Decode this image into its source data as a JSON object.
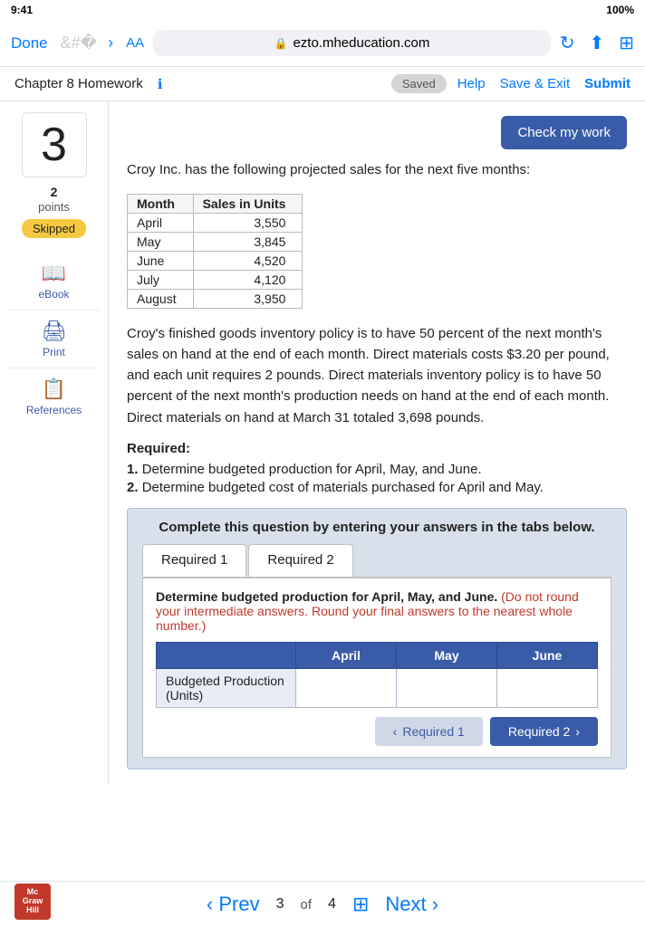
{
  "status_bar": {
    "left": "9:41",
    "right": "100%"
  },
  "browser": {
    "done_label": "Done",
    "aa_label": "AA",
    "url": "ezto.mheducation.com",
    "back_disabled": true,
    "forward_disabled": false
  },
  "top_nav": {
    "chapter_title": "Chapter 8 Homework",
    "saved_label": "Saved",
    "help_label": "Help",
    "save_exit_label": "Save & Exit",
    "submit_label": "Submit"
  },
  "question": {
    "number": "3",
    "points": "2",
    "points_label": "points",
    "status": "Skipped",
    "check_button_label": "Check my work"
  },
  "sidebar_tools": [
    {
      "icon": "📖",
      "label": "eBook"
    },
    {
      "icon": "🖨",
      "label": "Print"
    },
    {
      "icon": "📋",
      "label": "References"
    }
  ],
  "question_text": "Croy Inc. has the following projected sales for the next five months:",
  "sales_table": {
    "headers": [
      "Month",
      "Sales in Units"
    ],
    "rows": [
      [
        "April",
        "3,550"
      ],
      [
        "May",
        "3,845"
      ],
      [
        "June",
        "4,520"
      ],
      [
        "July",
        "4,120"
      ],
      [
        "August",
        "3,950"
      ]
    ]
  },
  "description": "Croy's finished goods inventory policy is to have 50 percent of the next month's sales on hand at the end of each month. Direct materials costs $3.20 per pound, and each unit requires 2 pounds. Direct materials inventory policy is to have 50 percent of the next month's production needs on hand at the end of each month. Direct materials on hand at March 31 totaled 3,698 pounds.",
  "required_header": "Required:",
  "required_items": [
    {
      "num": "1.",
      "text": "Determine budgeted production for April, May, and June."
    },
    {
      "num": "2.",
      "text": "Determine budgeted cost of materials purchased for April and May."
    }
  ],
  "complete_box": {
    "title": "Complete this question by entering your answers in the tabs below."
  },
  "tabs": [
    {
      "label": "Required 1",
      "active": true
    },
    {
      "label": "Required 2",
      "active": false
    }
  ],
  "tab1": {
    "instruction": "Determine budgeted production for April, May, and June.",
    "warning": "(Do not round your intermediate answers. Round your final answers to the nearest whole number.)",
    "table_headers": [
      "",
      "April",
      "May",
      "June"
    ],
    "row_label": "Budgeted Production (Units)",
    "april_value": "",
    "may_value": "",
    "june_value": ""
  },
  "tab_nav": {
    "back_label": "Required 1",
    "next_label": "Required 2"
  },
  "bottom": {
    "prev_label": "Prev",
    "page_current": "3",
    "page_of": "of",
    "page_total": "4",
    "next_label": "Next"
  },
  "mcgraw_logo": {
    "line1": "Mc",
    "line2": "Graw",
    "line3": "Hill"
  }
}
